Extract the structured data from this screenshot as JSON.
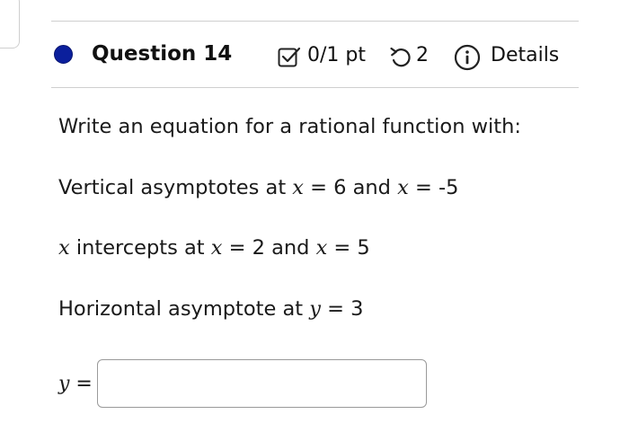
{
  "question": {
    "title": "Question 14",
    "score": "0/1 pt",
    "retries": "2",
    "details_label": "Details"
  },
  "colors": {
    "status_dot": "#0b1f9c",
    "rule": "#cfcfcf",
    "input_border": "#9a9a9a"
  },
  "icons": {
    "status": "status-dot-icon",
    "score": "checkbox-icon",
    "retry": "retry-icon",
    "details": "info-icon"
  },
  "prompt": {
    "intro": "Write an equation for a rational function with:",
    "vertical": {
      "text": "Vertical asymptotes at ",
      "v1": "x",
      "eq1": " = 6 and ",
      "v2": "x",
      "eq2": " = -5"
    },
    "intercepts": {
      "v0": "x",
      "text": " intercepts at ",
      "v1": "x",
      "eq1": " = 2 and ",
      "v2": "x",
      "eq2": " = 5"
    },
    "horizontal": {
      "text": "Horizontal asymptote at ",
      "v1": "y",
      "eq1": " = 3"
    }
  },
  "answer": {
    "var": "y",
    "eq": " =",
    "value": ""
  }
}
